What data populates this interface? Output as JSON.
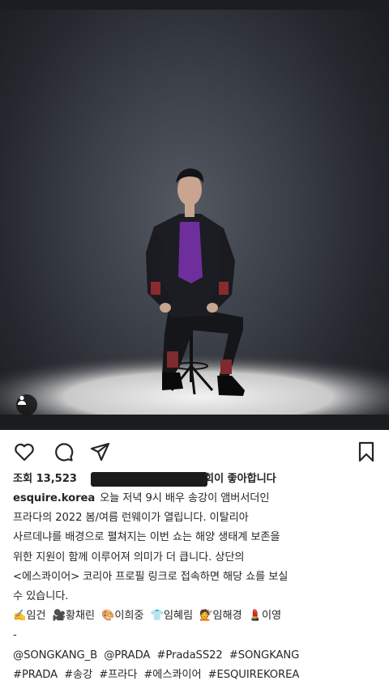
{
  "post": {
    "username": "esquire.korea",
    "likes": {
      "prefix": "조회",
      "count": "13,523",
      "suffix": "회이 좋아합니다"
    },
    "caption_lines": [
      "오늘 저녁 9시 배우 송강이 앰버서더인",
      "프라다의 2022 봄/여름 런웨이가 열립니다. 이탈리아",
      "사르데냐를 배경으로 펼쳐지는 이번 쇼는 해양 생태계 보존을",
      "위한 지원이 함께 이루어져 의미가 더 큽니다. 상단의",
      "<에스콰이어> 코리아 프로필 링크로 접속하면 해당 쇼를 보실",
      "수 있습니다."
    ],
    "credits": [
      {
        "icon": "✍️",
        "name": "임건"
      },
      {
        "icon": "🎥",
        "name": "황채린"
      },
      {
        "icon": "🎨",
        "name": "이희중"
      },
      {
        "icon": "👕",
        "name": "임혜림"
      },
      {
        "icon": "💇",
        "name": "임해경"
      },
      {
        "icon": "💄",
        "name": "이영"
      }
    ],
    "separator": "-",
    "tags_line1": [
      "@SONGKANG_B",
      "@PRADA",
      "#PradaSS22",
      "#SONGKANG"
    ],
    "tags_line2": [
      "#PRADA",
      "#송강",
      "#프라다",
      "#에스콰이어",
      "#ESQUIREKOREA"
    ]
  },
  "icons": {
    "like": "heart-icon",
    "comment": "comment-icon",
    "share": "send-icon",
    "save": "bookmark-icon",
    "tag": "person-tag-icon"
  },
  "colors": {
    "text": "#262626",
    "background": "#ffffff",
    "photo_shirt": "#6e2f9c",
    "photo_sleeve": "#8a2a2e"
  }
}
